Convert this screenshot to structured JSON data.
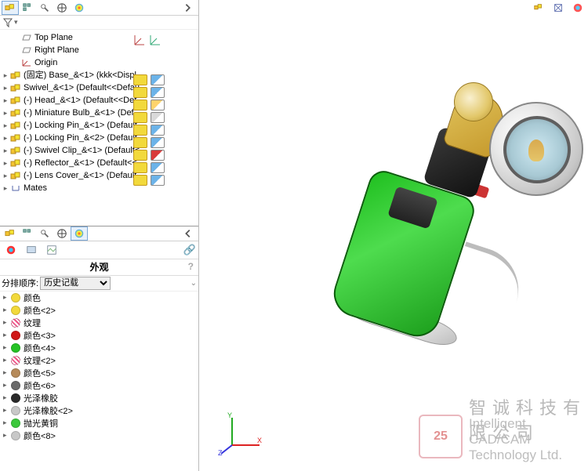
{
  "topTabs": {
    "count": 6
  },
  "tree": {
    "planes": {
      "top": "Top Plane",
      "right": "Right Plane",
      "origin": "Origin"
    },
    "components": [
      {
        "label": "(固定) Base_&<1> (kkk<Displ"
      },
      {
        "label": "Swivel_&<1> (Default<<Defau"
      },
      {
        "label": "(-) Head_&<1> (Default<<Def"
      },
      {
        "label": "(-) Miniature Bulb_&<1> (Def"
      },
      {
        "label": "(-) Locking Pin_&<1> (Default"
      },
      {
        "label": "(-) Locking Pin_&<2> (Default"
      },
      {
        "label": "(-) Swivel Clip_&<1> (Default<"
      },
      {
        "label": "(-) Reflector_&<1> (Default<<"
      },
      {
        "label": "(-) Lens Cover_&<1> (Default"
      }
    ],
    "mates": "Mates"
  },
  "appearance": {
    "title": "外观",
    "sortLabel": "分排顺序:",
    "sortValue": "历史记载",
    "items": [
      {
        "label": "颜色",
        "color": "#f2d93b",
        "type": "solid"
      },
      {
        "label": "颜色<2>",
        "color": "#f2d93b",
        "type": "solid"
      },
      {
        "label": "纹理",
        "color": "#ffffff",
        "type": "hatch"
      },
      {
        "label": "颜色<3>",
        "color": "#d01616",
        "type": "solid"
      },
      {
        "label": "颜色<4>",
        "color": "#25c225",
        "type": "solid"
      },
      {
        "label": "纹理<2>",
        "color": "#ffffff",
        "type": "hatch"
      },
      {
        "label": "颜色<5>",
        "color": "#b68a5a",
        "type": "solid"
      },
      {
        "label": "颜色<6>",
        "color": "#6a6a6a",
        "type": "solid"
      },
      {
        "label": "光泽橡胶",
        "color": "#2a2a2a",
        "type": "solid"
      },
      {
        "label": "光泽橡胶<2>",
        "color": "#c8c8c8",
        "type": "solid"
      },
      {
        "label": "抛光黄铜",
        "color": "#3cc83c",
        "type": "solid"
      },
      {
        "label": "颜色<8>",
        "color": "#c8c8c8",
        "type": "solid"
      }
    ]
  },
  "watermark": {
    "logo": "25",
    "cn": "智诚科技有限公司",
    "en": "Intelligent CAD/CAM Technology Ltd."
  }
}
